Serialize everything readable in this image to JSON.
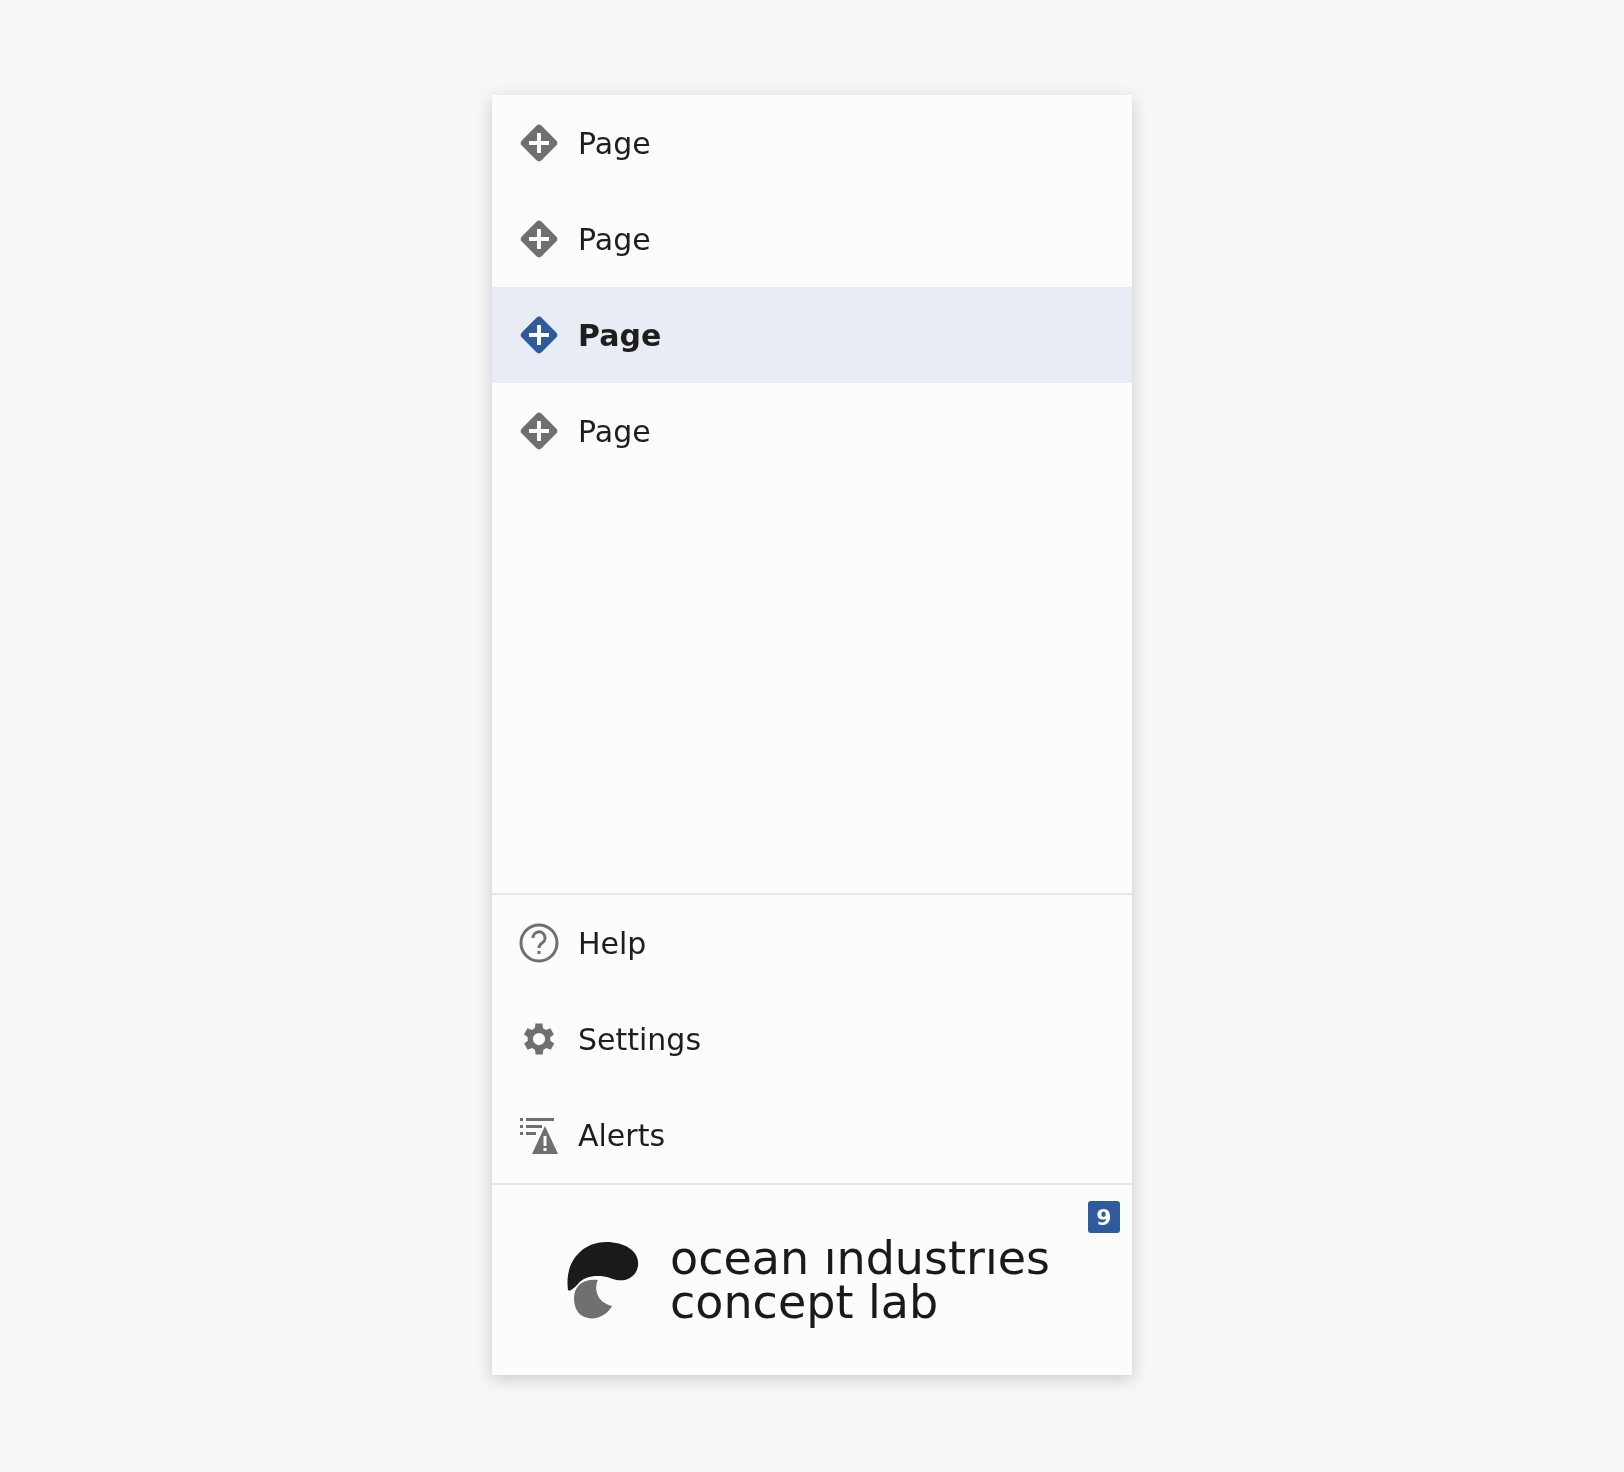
{
  "pages": [
    {
      "label": "Page",
      "selected": false
    },
    {
      "label": "Page",
      "selected": false
    },
    {
      "label": "Page",
      "selected": true
    },
    {
      "label": "Page",
      "selected": false
    }
  ],
  "utility_items": [
    {
      "kind": "help",
      "label": "Help"
    },
    {
      "kind": "settings",
      "label": "Settings"
    },
    {
      "kind": "alerts",
      "label": "Alerts"
    }
  ],
  "footer": {
    "badge": "9",
    "logo_lines": [
      "ocean ındustrıes",
      "concept lab"
    ]
  }
}
